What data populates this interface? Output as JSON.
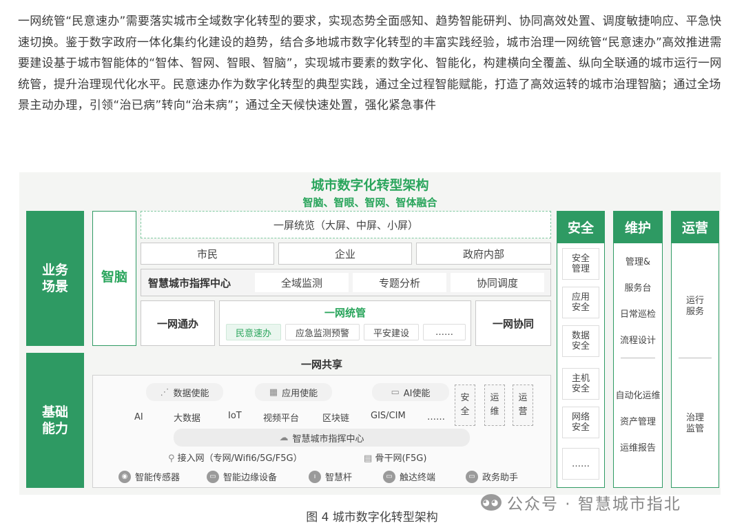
{
  "paragraph": "一网统管“民意速办”需要落实城市全域数字化转型的要求，实现态势全面感知、趋势智能研判、协同高效处置、调度敏捷响应、平急快速切换。鉴于数字政府一体化集约化建设的趋势，结合多地城市数字化转型的丰富实践经验，城市治理一网统管“民意速办”高效推进需要建设基于城市智能体的“智体、智网、智眼、智脑”，实现城市要素的数字化、智能化，构建横向全覆盖、纵向全联通的城市运行一网统管，提升治理现代化水平。民意速办作为数字化转型的典型实践，通过全过程智能赋能，打造了高效运转的城市治理智脑；通过全场景主动办理，引领“治已病”转向“治未病”；通过全天候快速处置，强化紧急事件",
  "diagram": {
    "title": "城市数字化转型架构",
    "subtitle": "智脑、智眼、智网、智体融合",
    "left": {
      "business": "业务\n场景",
      "foundation": "基础\n能力"
    },
    "brain": "智脑",
    "screen": "一屏统览（大屏、中屏、小屏）",
    "users": [
      "市民",
      "企业",
      "政府内部"
    ],
    "command": {
      "label": "智慧城市指挥中心",
      "items": [
        "全域监测",
        "专题分析",
        "协同调度"
      ]
    },
    "one_handle": "一网通办",
    "one_manage": {
      "title": "一网统管",
      "items": [
        "民意速办",
        "应急监测预警",
        "平安建设",
        "……"
      ]
    },
    "one_collab": "一网协同",
    "share": {
      "title": "一网共享",
      "enablers": [
        {
          "icon": "network-icon",
          "label": "数据使能"
        },
        {
          "icon": "apps-grid-icon",
          "label": "应用使能"
        },
        {
          "icon": "ai-chip-icon",
          "label": "AI使能"
        }
      ],
      "tech": [
        "AI",
        "大数据",
        "IoT",
        "视频平台",
        "区块链",
        "GIS/CIM",
        "……"
      ],
      "side_tags": [
        "安\n全",
        "运\n维",
        "运\n营"
      ],
      "cloud": "智慧城市指挥中心",
      "access_net": "接入网（专网/Wifi6/5G/F5G）",
      "backbone": "骨干网(F5G)",
      "devices": [
        "智能传感器",
        "智能边缘设备",
        "智慧杆",
        "触达终端",
        "政务助手"
      ]
    },
    "security": {
      "header": "安全",
      "items": [
        "安全\n管理",
        "应用\n安全",
        "数据\n安全",
        "主机\n安全",
        "网络\n安全",
        "……"
      ]
    },
    "maintenance": {
      "header": "维护",
      "items_top": [
        "管理&",
        "服务台",
        "日常巡检",
        "流程设计"
      ],
      "items_bottom": [
        "自动化运维",
        "资产管理",
        "运维报告"
      ]
    },
    "operation": {
      "header": "运营",
      "items_top": [
        "运行\n服务"
      ],
      "items_bottom": [
        "治理\n监管"
      ]
    }
  },
  "caption": "图 4 城市数字化转型架构",
  "watermark": "公众号 · 智慧城市指北"
}
